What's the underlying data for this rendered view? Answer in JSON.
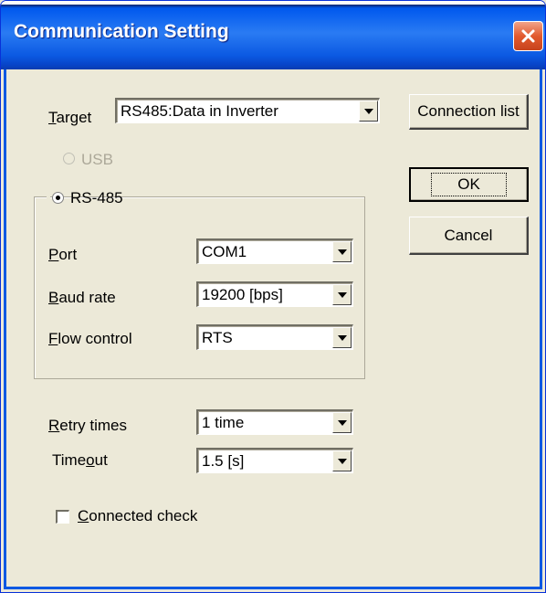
{
  "window": {
    "title": "Communication Setting"
  },
  "target": {
    "label_pre": "",
    "label_u": "T",
    "label_post": "arget",
    "value": "RS485:Data in Inverter"
  },
  "buttons": {
    "connection_list": "Connection list",
    "ok": "OK",
    "cancel": "Cancel"
  },
  "usb": {
    "label": "USB",
    "enabled": false
  },
  "rs485": {
    "label": "RS-485",
    "selected": true
  },
  "port": {
    "label_u": "P",
    "label_post": "ort",
    "value": "COM1"
  },
  "baud": {
    "label_u": "B",
    "label_post": "aud rate",
    "value": "19200 [bps]"
  },
  "flow": {
    "label_u": "F",
    "label_post": "low control",
    "value": "RTS"
  },
  "retry": {
    "label_u": "R",
    "label_post": "etry times",
    "value": "1 time"
  },
  "timeout": {
    "label_pre": "Time",
    "label_u": "o",
    "label_post": "ut",
    "value": "1.5 [s]"
  },
  "connected_check": {
    "label_u": "C",
    "label_post": "onnected check",
    "checked": false
  },
  "colors": {
    "titlebar": "#0b59e2",
    "close": "#e25a2e",
    "face": "#ece9d8"
  }
}
